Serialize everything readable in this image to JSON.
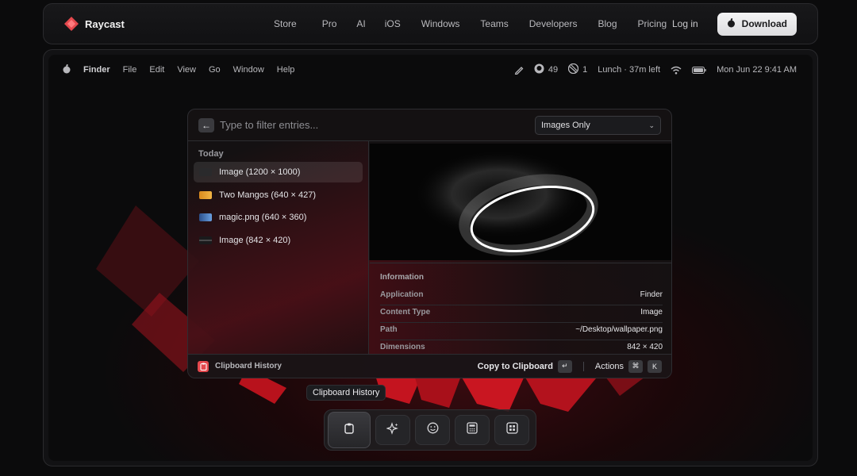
{
  "site": {
    "brand": "Raycast",
    "nav_links": [
      "Store",
      "Pro",
      "AI",
      "iOS",
      "Windows",
      "Teams",
      "Developers",
      "Blog",
      "Pricing"
    ],
    "login": "Log in",
    "download": "Download",
    "accent": "#e5484d"
  },
  "menubar": {
    "apple_icon": "apple-icon",
    "app": "Finder",
    "menus": [
      "File",
      "Edit",
      "View",
      "Go",
      "Window",
      "Help"
    ],
    "github_count": "49",
    "notification_count": "1",
    "event": "Lunch · 37m left",
    "datetime": "Mon Jun 22  9:41 AM"
  },
  "raycast": {
    "search_placeholder": "Type to filter entries...",
    "filter_value": "Images Only",
    "section": "Today",
    "items": [
      {
        "label": "Image (1200 × 1000)"
      },
      {
        "label": "Two Mangos (640 × 427)"
      },
      {
        "label": "magic.png (640 × 360)"
      },
      {
        "label": "Image (842 × 420)"
      }
    ],
    "info": {
      "title": "Information",
      "rows": [
        {
          "key": "Application",
          "value": "Finder"
        },
        {
          "key": "Content Type",
          "value": "Image"
        },
        {
          "key": "Path",
          "value": "~/Desktop/wallpaper.png"
        },
        {
          "key": "Dimensions",
          "value": "842 × 420"
        }
      ]
    },
    "footer": {
      "title": "Clipboard History",
      "primary_action": "Copy to Clipboard",
      "primary_key": "↵",
      "actions": "Actions",
      "actions_keys": [
        "⌘",
        "K"
      ]
    }
  },
  "tooltip": "Clipboard History",
  "dock": [
    "clipboard-icon",
    "sparkles-icon",
    "emoji-icon",
    "calculator-icon",
    "grid-icon"
  ]
}
